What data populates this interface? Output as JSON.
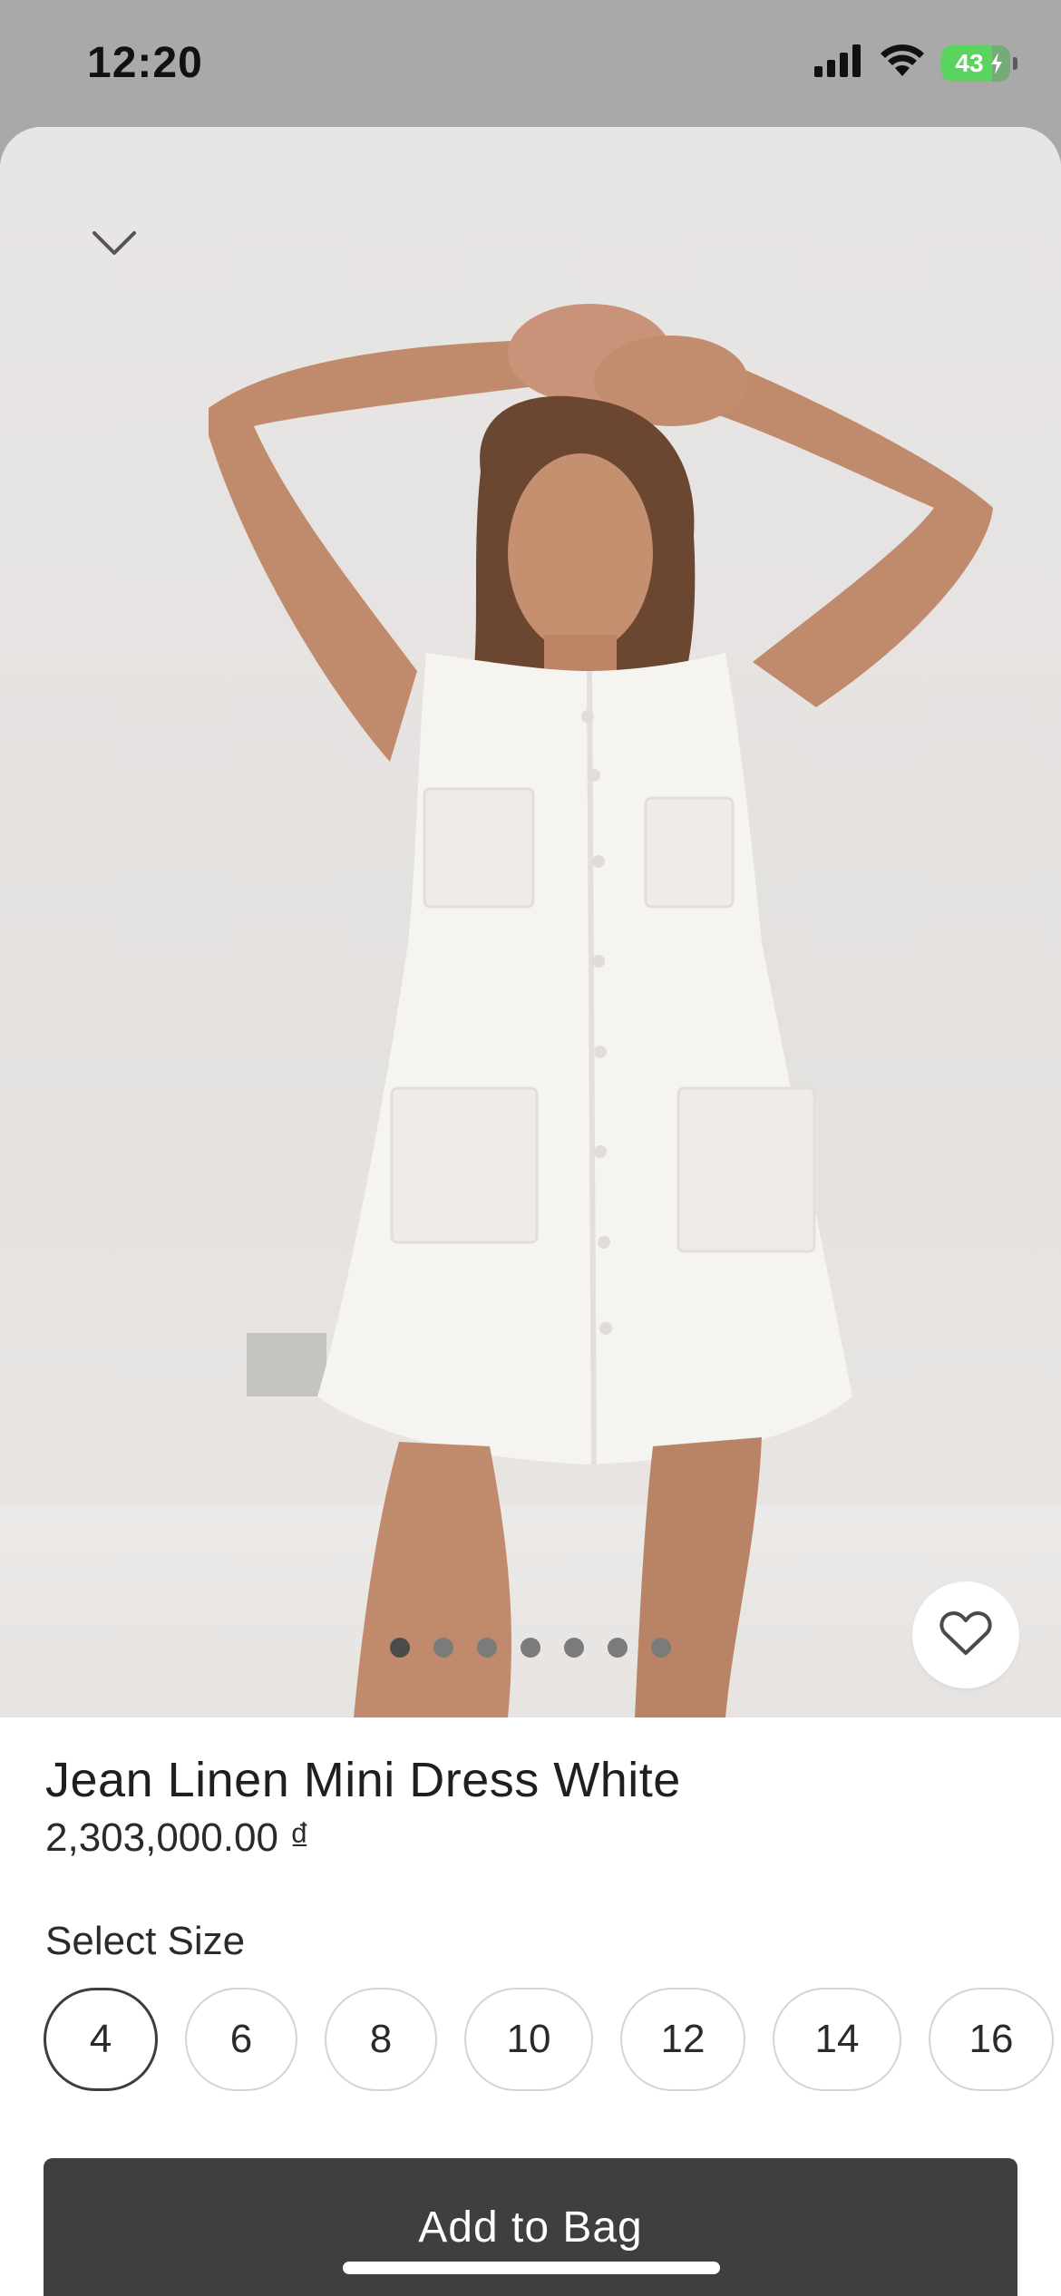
{
  "status_bar": {
    "time": "12:20",
    "battery_level": "43",
    "icons": [
      "cellular-signal-icon",
      "wifi-icon",
      "battery-charging-icon"
    ]
  },
  "product": {
    "title": "Jean Linen Mini Dress White",
    "price": "2,303,000.00 ₫",
    "image_count": 7,
    "active_image_index": 0
  },
  "size_selector": {
    "label": "Select Size",
    "options": [
      "4",
      "6",
      "8",
      "10",
      "12",
      "14",
      "16"
    ],
    "selected": "4"
  },
  "actions": {
    "add_to_bag_label": "Add to Bag",
    "favorite_icon": "heart-outline-icon",
    "collapse_icon": "chevron-down-icon"
  },
  "colors": {
    "accent_button": "#3f3f3f",
    "status_bar_bg": "#a9a9a9",
    "battery": "#5bd35f"
  }
}
